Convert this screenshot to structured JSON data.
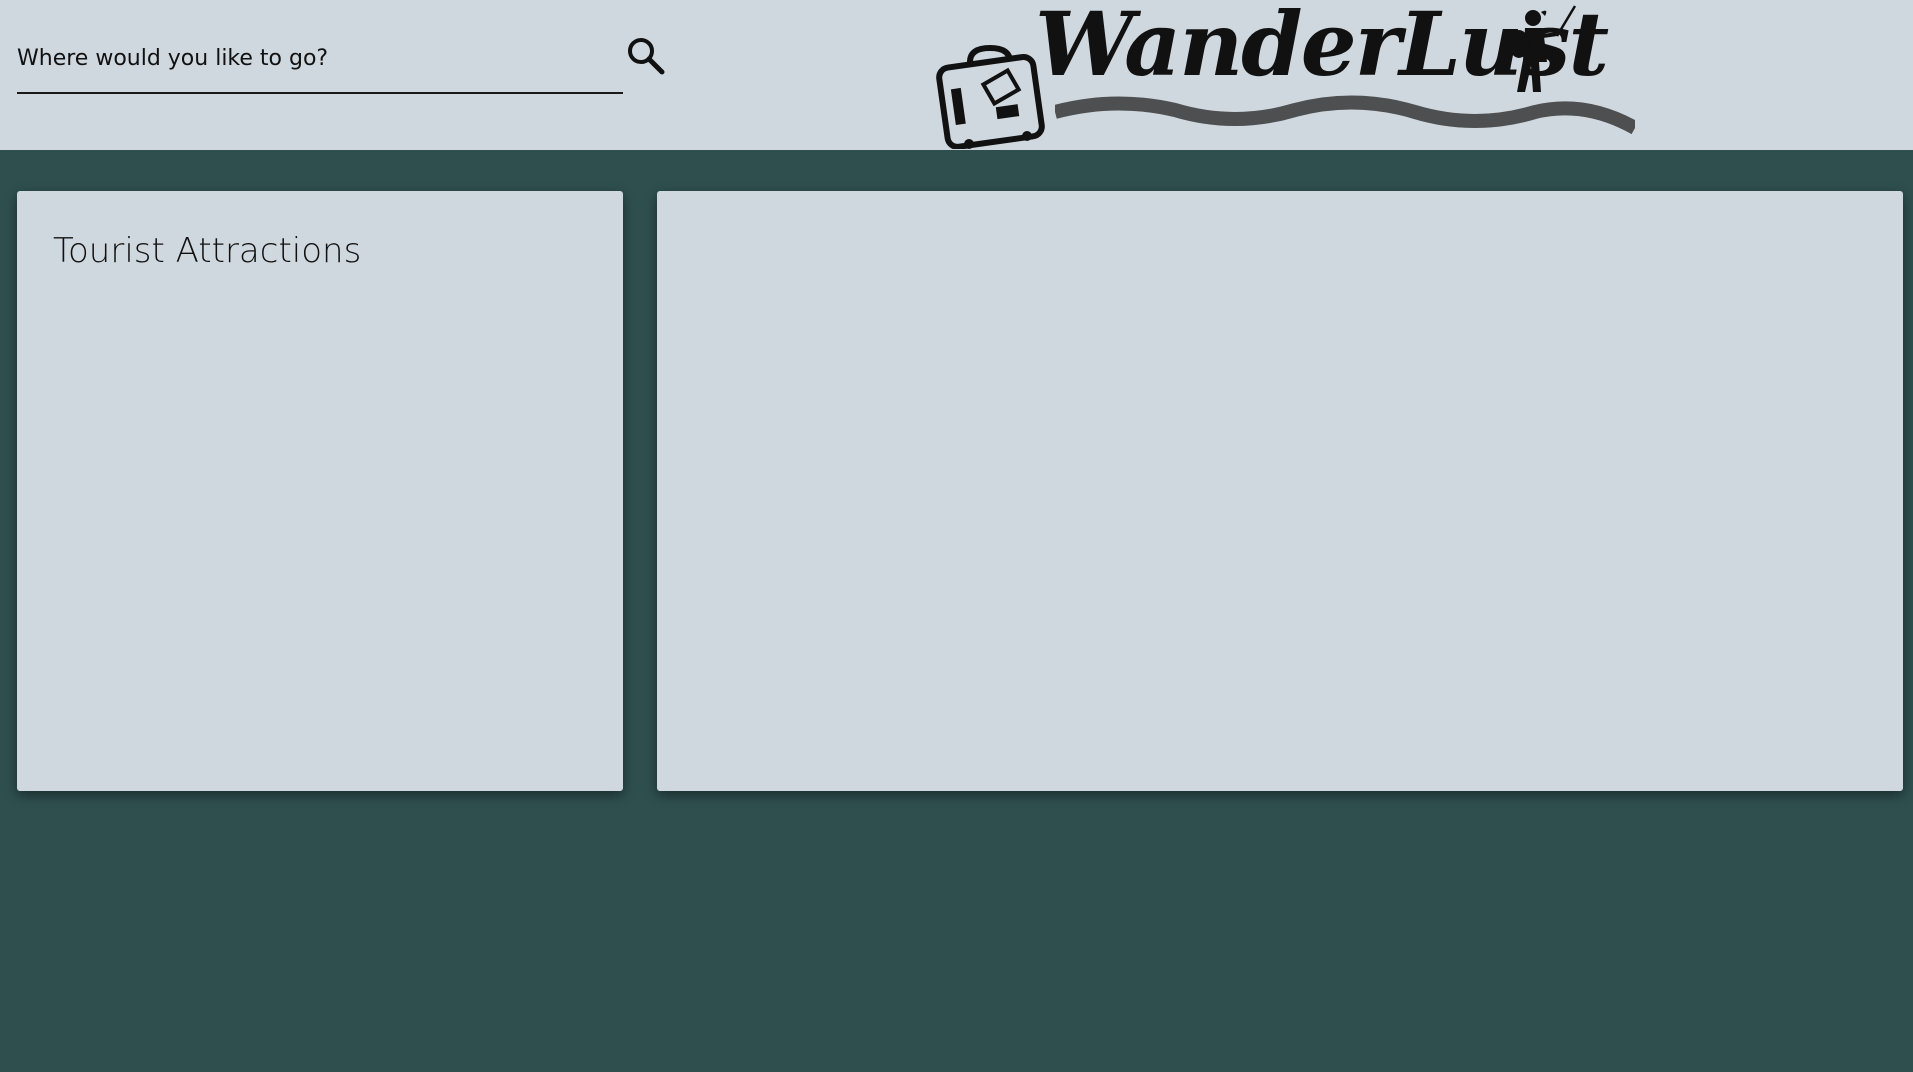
{
  "search": {
    "placeholder": "Where would you like to go?",
    "value": "",
    "button_icon": "search-icon"
  },
  "brand": {
    "logo_text": "WanderLust",
    "logo_icons": [
      "suitcase-icon",
      "hiker-icon"
    ]
  },
  "attractions_panel": {
    "title": "Tourist Attractions"
  },
  "colors": {
    "background": "#2f4f4f",
    "header": "#d0d8df",
    "panel": "#d0d8df",
    "text": "#111111"
  }
}
